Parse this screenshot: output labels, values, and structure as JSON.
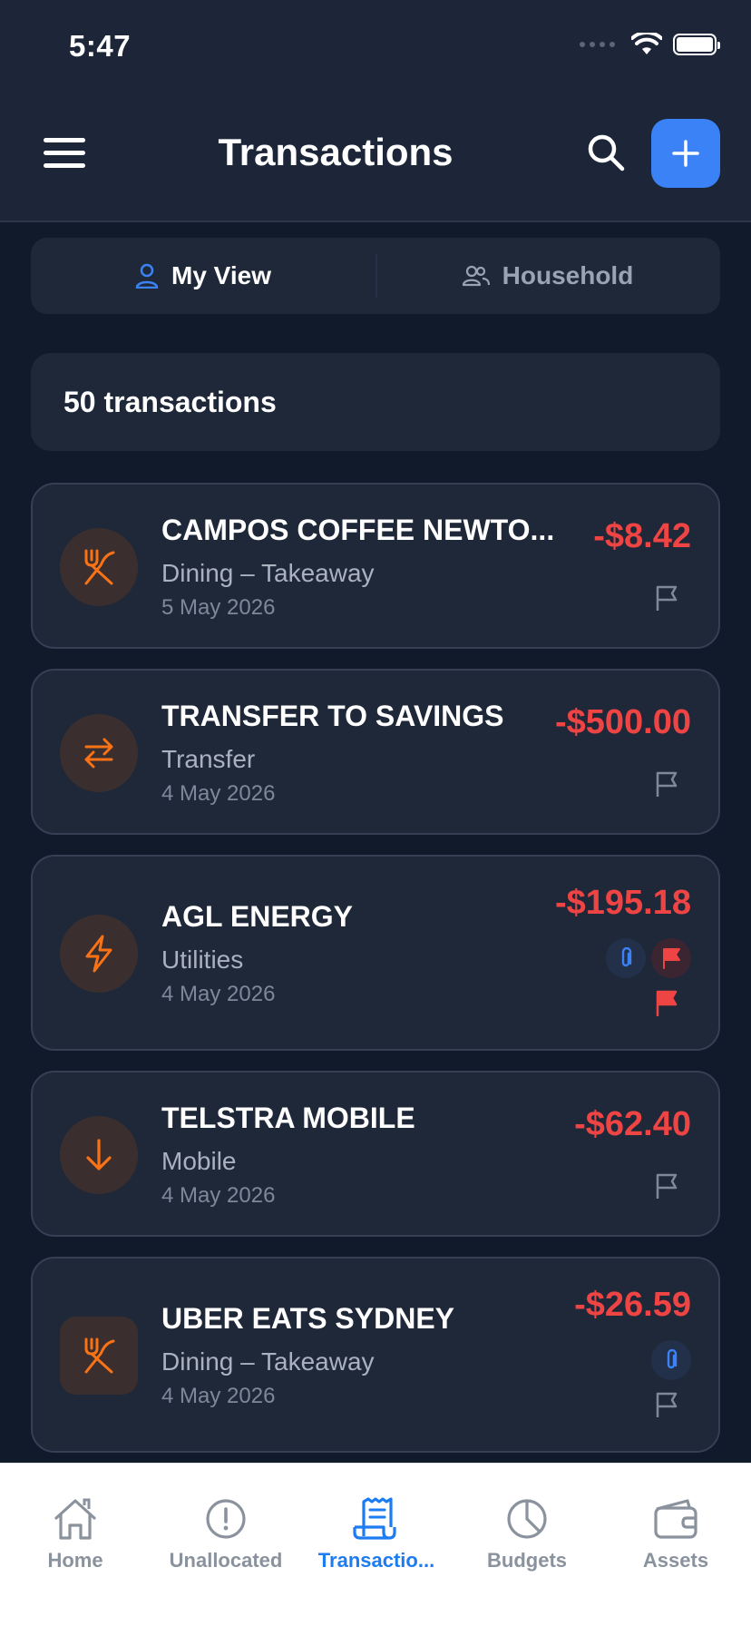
{
  "status_bar": {
    "time": "5:47"
  },
  "header": {
    "title": "Transactions"
  },
  "view_toggle": {
    "my_view": "My View",
    "household": "Household"
  },
  "summary": {
    "count_text": "50 transactions"
  },
  "transactions": [
    {
      "merchant": "CAMPOS COFFEE NEWTO...",
      "category": "Dining – Takeaway",
      "date": "5 May 2026",
      "amount": "-$8.42",
      "icon": "cutlery-icon"
    },
    {
      "merchant": "TRANSFER TO SAVINGS",
      "category": "Transfer",
      "date": "4 May 2026",
      "amount": "-$500.00",
      "icon": "transfer-arrows-icon"
    },
    {
      "merchant": "AGL ENERGY",
      "category": "Utilities",
      "date": "4 May 2026",
      "amount": "-$195.18",
      "icon": "lightning-icon"
    },
    {
      "merchant": "TELSTRA MOBILE",
      "category": "Mobile",
      "date": "4 May 2026",
      "amount": "-$62.40",
      "icon": "arrow-down-icon"
    },
    {
      "merchant": "UBER EATS SYDNEY",
      "category": "Dining – Takeaway",
      "date": "4 May 2026",
      "amount": "-$26.59",
      "icon": "cutlery-icon"
    }
  ],
  "tab_bar": {
    "tabs": [
      {
        "label": "Home",
        "icon": "home-icon"
      },
      {
        "label": "Unallocated",
        "icon": "alert-circle-icon"
      },
      {
        "label": "Transactio...",
        "icon": "receipt-icon",
        "active": true
      },
      {
        "label": "Budgets",
        "icon": "pie-chart-icon"
      },
      {
        "label": "Assets",
        "icon": "wallet-icon"
      }
    ]
  },
  "colors": {
    "accent": "#3b82f6",
    "negative_amount": "#ef4444",
    "category_icon": "#f97316",
    "active_tab": "#1d7cf2"
  }
}
